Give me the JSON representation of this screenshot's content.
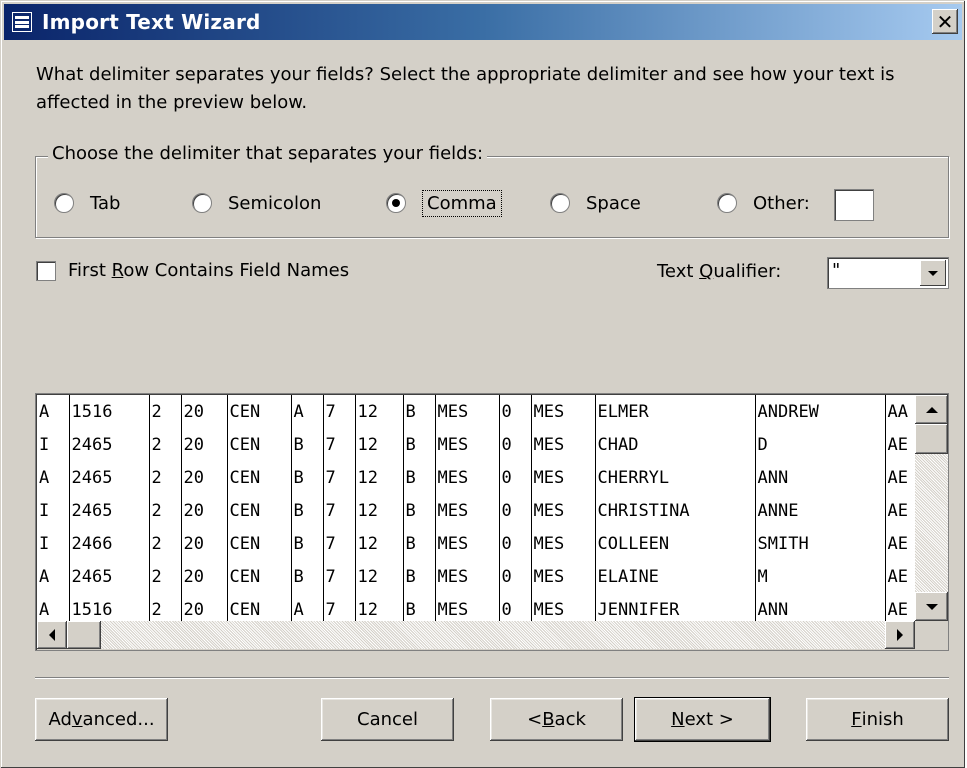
{
  "window": {
    "title": "Import Text Wizard",
    "close_glyph": "✕"
  },
  "intro": {
    "text": "What delimiter separates your fields? Select the appropriate delimiter and see how your text is affected in the preview below."
  },
  "delimiter_group": {
    "legend": "Choose the delimiter that separates your fields:",
    "options": [
      {
        "label": "Tab",
        "checked": false
      },
      {
        "label": "Semicolon",
        "checked": false
      },
      {
        "label": "Comma",
        "checked": true
      },
      {
        "label": "Space",
        "checked": false
      },
      {
        "label": "Other:",
        "checked": false
      }
    ],
    "other_value": ""
  },
  "first_row": {
    "label_pre": "First ",
    "label_mnemonic": "R",
    "label_post": "ow Contains Field Names",
    "checked": false
  },
  "text_qualifier": {
    "label_pre": "Text ",
    "label_mnemonic": "Q",
    "label_post": "ualifier:",
    "value": "\""
  },
  "preview": {
    "rows": [
      [
        "A",
        "1516",
        "2",
        "20",
        "CEN",
        "A",
        "7",
        "12",
        "B",
        "MES",
        "0",
        "MES",
        "ELMER",
        "ANDREW",
        "AA"
      ],
      [
        "I",
        "2465",
        "2",
        "20",
        "CEN",
        "B",
        "7",
        "12",
        "B",
        "MES",
        "0",
        "MES",
        "CHAD",
        "D",
        "AE"
      ],
      [
        "A",
        "2465",
        "2",
        "20",
        "CEN",
        "B",
        "7",
        "12",
        "B",
        "MES",
        "0",
        "MES",
        "CHERRYL",
        "ANN",
        "AE"
      ],
      [
        "I",
        "2465",
        "2",
        "20",
        "CEN",
        "B",
        "7",
        "12",
        "B",
        "MES",
        "0",
        "MES",
        "CHRISTINA",
        "ANNE",
        "AE"
      ],
      [
        "I",
        "2466",
        "2",
        "20",
        "CEN",
        "B",
        "7",
        "12",
        "B",
        "MES",
        "0",
        "MES",
        "COLLEEN",
        "SMITH",
        "AE"
      ],
      [
        "A",
        "2465",
        "2",
        "20",
        "CEN",
        "B",
        "7",
        "12",
        "B",
        "MES",
        "0",
        "MES",
        "ELAINE",
        "M",
        "AE"
      ],
      [
        "A",
        "1516",
        "2",
        "20",
        "CEN",
        "A",
        "7",
        "12",
        "B",
        "MES",
        "0",
        "MES",
        "JENNIFER",
        "ANN",
        "AE"
      ]
    ]
  },
  "buttons": {
    "advanced": {
      "pre": "Ad",
      "mnemonic": "v",
      "post": "anced..."
    },
    "cancel": {
      "pre": "Cancel",
      "mnemonic": "",
      "post": ""
    },
    "back": {
      "pre": "< ",
      "mnemonic": "B",
      "post": "ack"
    },
    "next": {
      "pre": "",
      "mnemonic": "N",
      "post": "ext >"
    },
    "finish": {
      "pre": "",
      "mnemonic": "F",
      "post": "inish"
    }
  },
  "colors": {
    "titlebar_start": "#0a246a",
    "titlebar_end": "#a6caf0",
    "face": "#d4d0c8"
  }
}
